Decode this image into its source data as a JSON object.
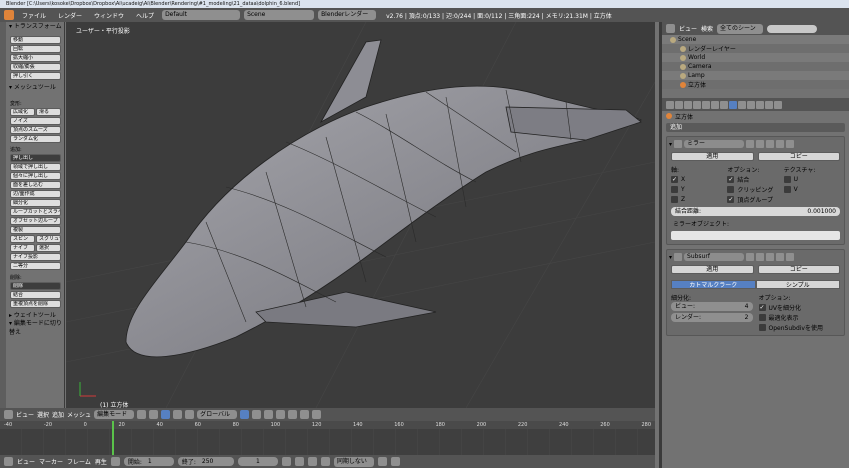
{
  "window": {
    "title": "Blender [C:\\Users\\kosoke\\Dropbox\\Dropbox\\Ai\\ucadeig\\Ai\\Blender\\Rendering\\#1_modeling\\21_dataa\\dolphin_6.blend]"
  },
  "menubar": {
    "items": [
      "ファイル",
      "レンダー",
      "ウィンドウ",
      "ヘルプ"
    ],
    "screen": "Default",
    "scene": "Scene",
    "engine": "Blenderレンダー",
    "stats": "v2.76 | 頂点:0/133 | 辺:0/244 | 面:0/112 | 三角面:224 | メモリ:21.31M | 立方体"
  },
  "toolshelf": {
    "transform_header": "▾ トランスフォーム",
    "transform": [
      "移動",
      "回転",
      "拡大縮小",
      "収縮/膨張",
      "押し引く"
    ],
    "mesh_tools_header": "▾ メッシュツール",
    "deform_label": "変形:",
    "deform_row1": [
      "広域化",
      "滑る"
    ],
    "deform_items": [
      "ノイズ",
      "頂点のスムーズ",
      "ランダム化"
    ],
    "add_label": "追加:",
    "add_items": [
      "押し出し",
      "領域で押し出し",
      "個々に押し出し",
      "面を差し込む",
      "辺/面作成",
      "細分化",
      "ループカットとスライド",
      "オフセット辺ループ",
      "複製"
    ],
    "add_pairs": [
      [
        "スピン",
        "スクリュー"
      ],
      [
        "ナイフ",
        "選択"
      ]
    ],
    "add_more": [
      "ナイフ投影",
      "二等分"
    ],
    "remove_label": "削除:",
    "remove_items": [
      "削除",
      "結合",
      "重複頂点を削除"
    ],
    "weight_header": "▸ ウェイトツール",
    "last_op": "▾ 編集モードに切り替え"
  },
  "viewport": {
    "label": "ユーザー・平行投影",
    "object_label": "(1) 立方体"
  },
  "view_header": {
    "items": [
      "ビュー",
      "選択",
      "追加",
      "メッシュ"
    ],
    "mode": "編集モード",
    "orientation": "グローバル"
  },
  "timeline": {
    "ruler": [
      "-40",
      "-20",
      "0",
      "20",
      "40",
      "60",
      "80",
      "100",
      "120",
      "140",
      "160",
      "180",
      "200",
      "220",
      "240",
      "260",
      "280"
    ],
    "items": [
      "ビュー",
      "マーカー",
      "フレーム",
      "再生"
    ],
    "start_label": "開始:",
    "start": "1",
    "end_label": "終了:",
    "end": "250",
    "current": "1",
    "sync": "同期しない"
  },
  "outliner": {
    "view": "ビュー",
    "search_label": "検索",
    "filter": "全てのシーン",
    "tree": [
      {
        "label": "Scene",
        "indent": 0
      },
      {
        "label": "レンダーレイヤー",
        "indent": 1
      },
      {
        "label": "World",
        "indent": 1
      },
      {
        "label": "Camera",
        "indent": 1
      },
      {
        "label": "Lamp",
        "indent": 1
      },
      {
        "label": "立方体",
        "indent": 1
      }
    ]
  },
  "properties": {
    "object_name": "立方体",
    "add_modifier": "追加",
    "mirror": {
      "name": "ミラー",
      "apply": "適用",
      "copy": "コピー",
      "axis_label": "軸:",
      "options_label": "オプション:",
      "texture_label": "テクスチャ:",
      "axes": [
        "X",
        "Y",
        "Z"
      ],
      "axes_checked": [
        true,
        false,
        false
      ],
      "options": [
        "結合",
        "クリッピング",
        "頂点グループ"
      ],
      "options_checked": [
        true,
        false,
        true
      ],
      "tex": [
        "U",
        "V"
      ],
      "merge_label": "結合距離:",
      "merge_value": "0.001000",
      "mirror_object_label": "ミラーオブジェクト:"
    },
    "subsurf": {
      "name": "Subsurf",
      "apply": "適用",
      "copy": "コピー",
      "tabs": [
        "カトマルクラーク",
        "シンプル"
      ],
      "subdiv_label": "細分化:",
      "view_label": "ビュー:",
      "view_value": "4",
      "render_label": "レンダー:",
      "render_value": "2",
      "options_label": "オプション:",
      "options": [
        "UVを細分化",
        "最適化表示",
        "OpenSubdivを使用"
      ],
      "options_checked": [
        true,
        false,
        false
      ]
    }
  },
  "colors": {
    "accent": "#5680c2",
    "current_frame": "#5ac24a"
  }
}
